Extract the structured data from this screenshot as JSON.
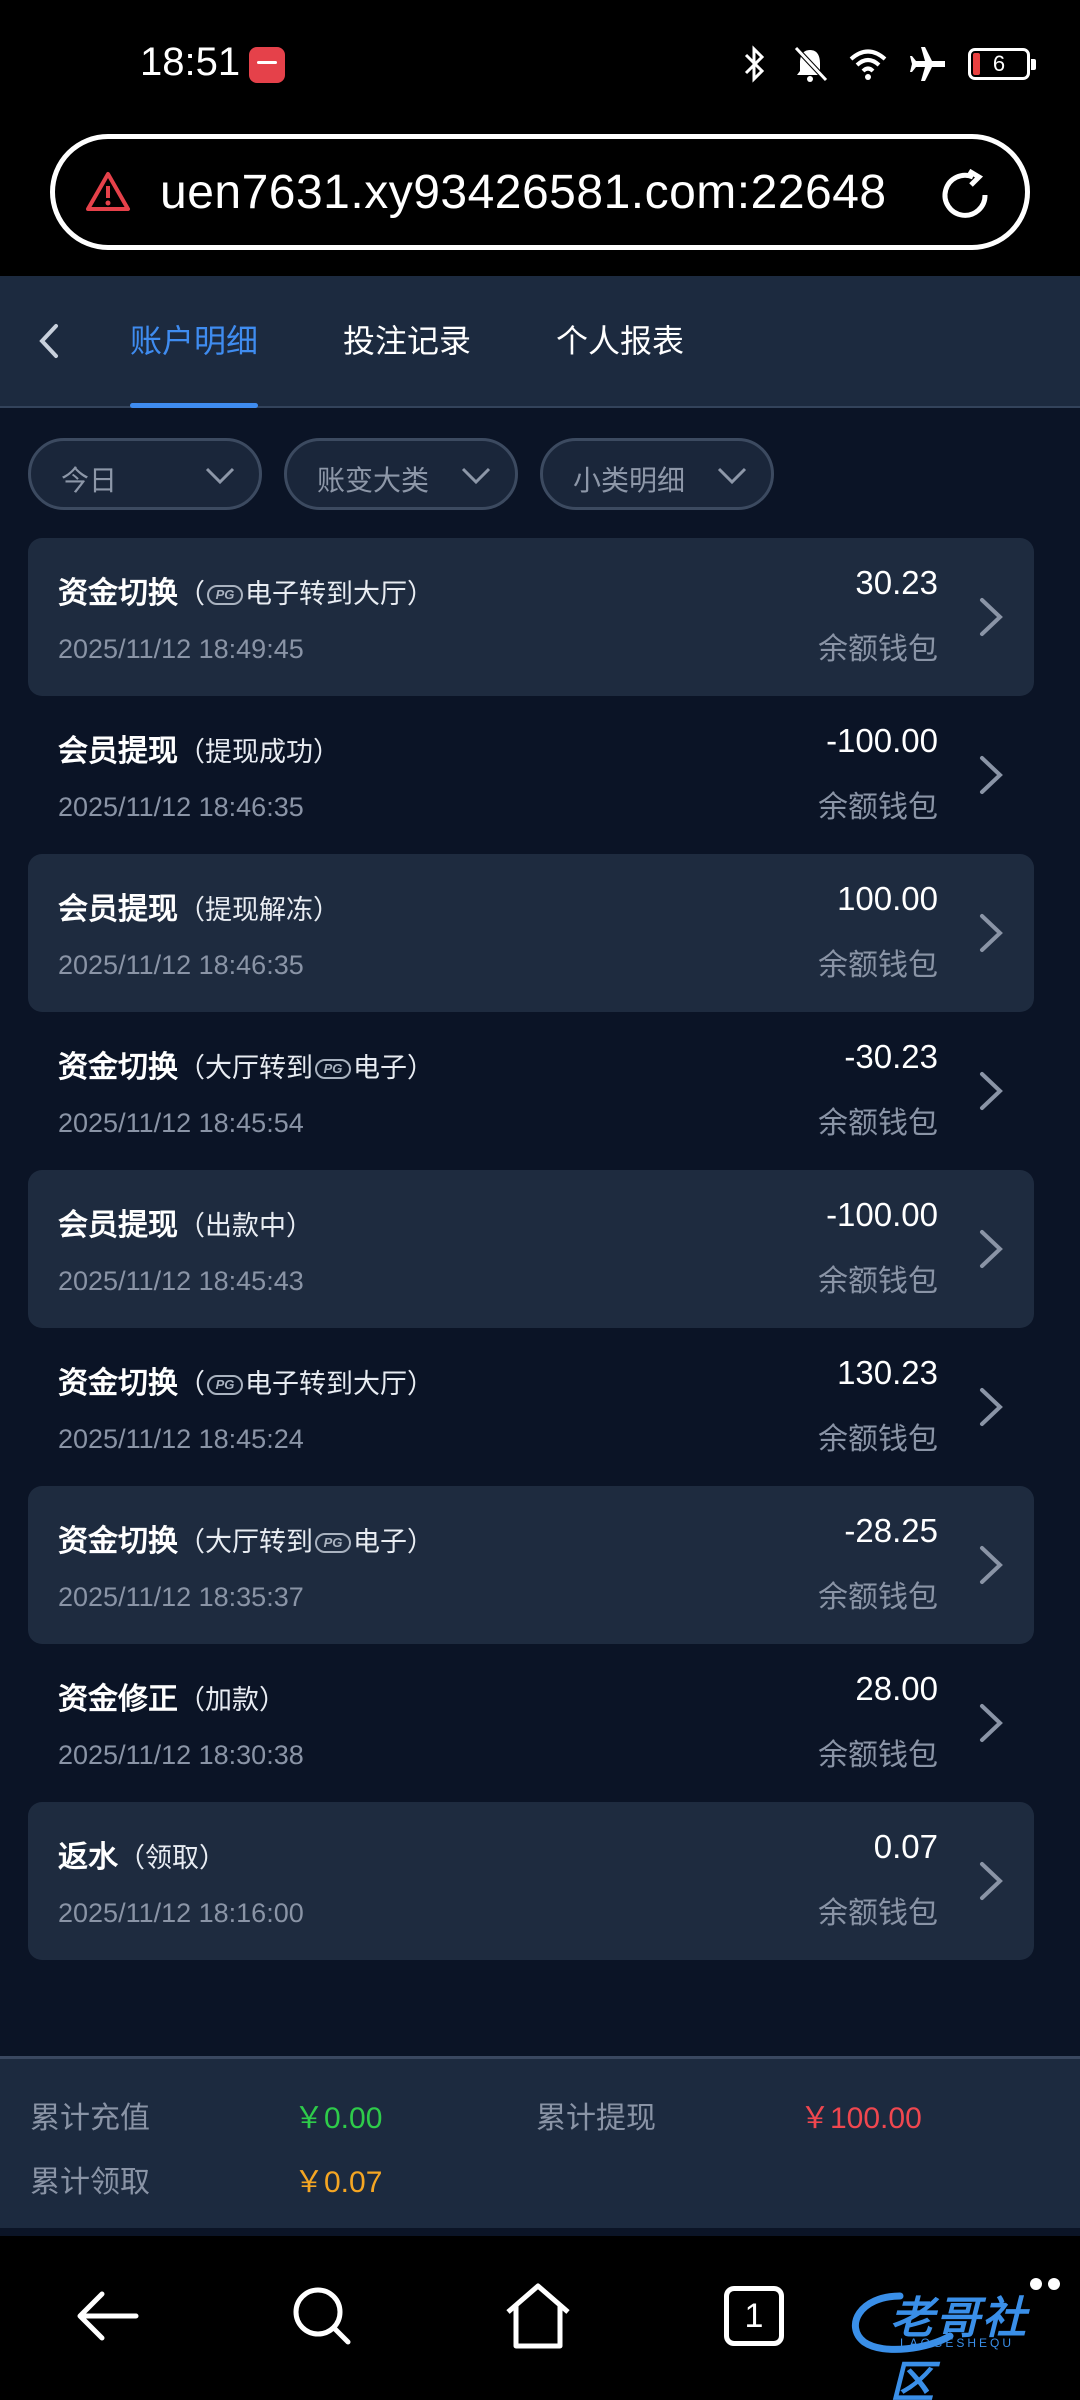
{
  "status_bar": {
    "time": "18:51",
    "battery_level": "6"
  },
  "url_bar": {
    "url": "uen7631.xy93426581.com:22648"
  },
  "tabs": [
    {
      "label": "账户明细",
      "active": true
    },
    {
      "label": "投注记录",
      "active": false
    },
    {
      "label": "个人报表",
      "active": false
    }
  ],
  "filters": [
    {
      "label": "今日"
    },
    {
      "label": "账变大类"
    },
    {
      "label": "小类明细"
    }
  ],
  "records": [
    {
      "type": "资金切换",
      "detail_pre": "（",
      "pg": true,
      "detail_post": "电子转到大厅）",
      "time": "2025/11/12 18:49:45",
      "amount": "30.23",
      "wallet": "余额钱包"
    },
    {
      "type": "会员提现",
      "detail_pre": "（提现成功）",
      "pg": false,
      "detail_post": "",
      "time": "2025/11/12 18:46:35",
      "amount": "-100.00",
      "wallet": "余额钱包"
    },
    {
      "type": "会员提现",
      "detail_pre": "（提现解冻）",
      "pg": false,
      "detail_post": "",
      "time": "2025/11/12 18:46:35",
      "amount": "100.00",
      "wallet": "余额钱包"
    },
    {
      "type": "资金切换",
      "detail_pre": "（大厅转到",
      "pg": true,
      "detail_post": "电子）",
      "time": "2025/11/12 18:45:54",
      "amount": "-30.23",
      "wallet": "余额钱包"
    },
    {
      "type": "会员提现",
      "detail_pre": "（出款中）",
      "pg": false,
      "detail_post": "",
      "time": "2025/11/12 18:45:43",
      "amount": "-100.00",
      "wallet": "余额钱包"
    },
    {
      "type": "资金切换",
      "detail_pre": "（",
      "pg": true,
      "detail_post": "电子转到大厅）",
      "time": "2025/11/12 18:45:24",
      "amount": "130.23",
      "wallet": "余额钱包"
    },
    {
      "type": "资金切换",
      "detail_pre": "（大厅转到",
      "pg": true,
      "detail_post": "电子）",
      "time": "2025/11/12 18:35:37",
      "amount": "-28.25",
      "wallet": "余额钱包"
    },
    {
      "type": "资金修正",
      "detail_pre": "（加款）",
      "pg": false,
      "detail_post": "",
      "time": "2025/11/12 18:30:38",
      "amount": "28.00",
      "wallet": "余额钱包"
    },
    {
      "type": "返水",
      "detail_pre": "（领取）",
      "pg": false,
      "detail_post": "",
      "time": "2025/11/12 18:16:00",
      "amount": "0.07",
      "wallet": "余额钱包"
    }
  ],
  "summary": {
    "total_recharge_label": "累计充值",
    "total_recharge_value": "￥0.00",
    "total_withdraw_label": "累计提现",
    "total_withdraw_value": "￥100.00",
    "total_claim_label": "累计领取",
    "total_claim_value": "￥0.07"
  },
  "nav": {
    "tab_count": "1"
  },
  "watermark": {
    "text": "老哥社区",
    "sub": "LAOGESHEQU"
  },
  "colors": {
    "accent": "#3f8cf0",
    "green": "#2ecc4a",
    "red": "#f0474f",
    "orange": "#f5a623"
  }
}
